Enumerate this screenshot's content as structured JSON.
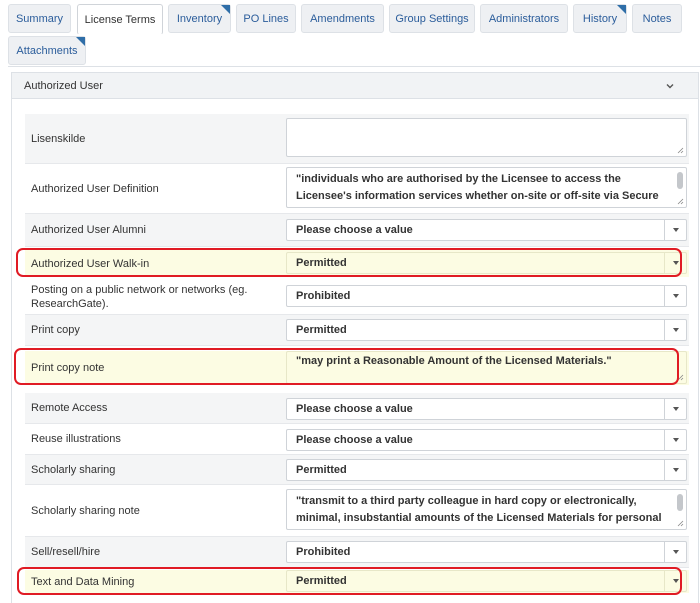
{
  "tabs": [
    {
      "label": "Summary",
      "active": false,
      "flag": false
    },
    {
      "label": "License Terms",
      "active": true,
      "flag": false
    },
    {
      "label": "Inventory",
      "active": false,
      "flag": true
    },
    {
      "label": "PO Lines",
      "active": false,
      "flag": false
    },
    {
      "label": "Amendments",
      "active": false,
      "flag": false
    },
    {
      "label": "Group Settings",
      "active": false,
      "flag": false
    },
    {
      "label": "Administrators",
      "active": false,
      "flag": false
    },
    {
      "label": "History",
      "active": false,
      "flag": true
    },
    {
      "label": "Notes",
      "active": false,
      "flag": false
    },
    {
      "label": "Attachments",
      "active": false,
      "flag": true
    }
  ],
  "panel": {
    "title": "Authorized User",
    "chevron_icon": "chevron-down-icon"
  },
  "terms": [
    {
      "label": "Lisenskilde",
      "type": "text",
      "value": ""
    },
    {
      "label": "Authorized User Definition",
      "type": "text",
      "value": "\"individuals who are authorised by the Licensee to access the Licensee's information services whether on-site or off-site via Secure Authentication and who are affiliated"
    },
    {
      "label": "Authorized User Alumni",
      "type": "select",
      "value": "Please choose a value"
    },
    {
      "label": "Authorized User Walk-in",
      "type": "select",
      "value": "Permitted",
      "highlighted": true
    },
    {
      "label": "Posting on a public network or networks (eg. ResearchGate).",
      "type": "select",
      "value": "Prohibited"
    },
    {
      "label": "Print copy",
      "type": "select",
      "value": "Permitted"
    },
    {
      "label": "Print copy note",
      "type": "text",
      "value": "\"may print a Reasonable Amount of the Licensed Materials.\"",
      "highlighted": true
    },
    {
      "label": "Remote Access",
      "type": "select",
      "value": "Please choose a value"
    },
    {
      "label": "Reuse illustrations",
      "type": "select",
      "value": "Please choose a value"
    },
    {
      "label": "Scholarly sharing",
      "type": "select",
      "value": "Permitted"
    },
    {
      "label": "Scholarly sharing note",
      "type": "text",
      "value": "\"transmit to a third party colleague in hard copy or electronically, minimal, insubstantial amounts of the Licensed Materials for personal use or scholarly,"
    },
    {
      "label": "Sell/resell/hire",
      "type": "select",
      "value": "Prohibited"
    },
    {
      "label": "Text and Data Mining",
      "type": "select",
      "value": "Permitted",
      "highlighted": true
    }
  ],
  "colors": {
    "accent": "#2b5d9b",
    "highlight_fill": "#fcfce3",
    "highlight_ring": "#e01b24"
  }
}
